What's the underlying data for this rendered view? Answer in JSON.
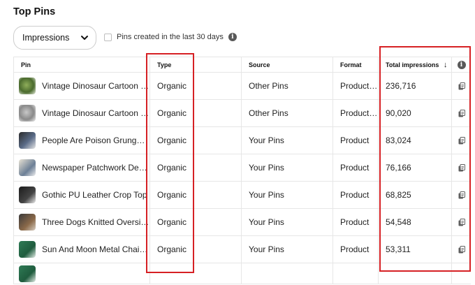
{
  "title": "Top Pins",
  "metric_dropdown": {
    "selected": "Impressions",
    "icon": "chevron-down-icon"
  },
  "filter": {
    "label": "Pins created in the last 30 days",
    "checked": false,
    "icon": "info-icon"
  },
  "table": {
    "columns": [
      "Pin",
      "Type",
      "Source",
      "Format",
      "Total impressions"
    ],
    "sort_icon": "↓",
    "info_icon": "i",
    "rows": [
      {
        "pin": "Vintage Dinosaur Cartoon Print",
        "type": "Organic",
        "source": "Other Pins",
        "format": "Product Pin",
        "impressions": "236,716"
      },
      {
        "pin": "Vintage Dinosaur Cartoon Print",
        "type": "Organic",
        "source": "Other Pins",
        "format": "Product Pin",
        "impressions": "90,020"
      },
      {
        "pin": "People Are Poison Grunge Hoodie",
        "type": "Organic",
        "source": "Your Pins",
        "format": "Product",
        "impressions": "83,024"
      },
      {
        "pin": "Newspaper Patchwork Denim Jacket",
        "type": "Organic",
        "source": "Your Pins",
        "format": "Product",
        "impressions": "76,166"
      },
      {
        "pin": "Gothic PU Leather Crop Top",
        "type": "Organic",
        "source": "Your Pins",
        "format": "Product",
        "impressions": "68,825"
      },
      {
        "pin": "Three Dogs Knitted Oversized Sweater",
        "type": "Organic",
        "source": "Your Pins",
        "format": "Product",
        "impressions": "54,548"
      },
      {
        "pin": "Sun And Moon Metal Chain Necklace",
        "type": "Organic",
        "source": "Your Pins",
        "format": "Product",
        "impressions": "53,311"
      }
    ]
  },
  "colors": {
    "highlight": "#d62024",
    "border": "#e6e6e6",
    "text": "#111111"
  }
}
